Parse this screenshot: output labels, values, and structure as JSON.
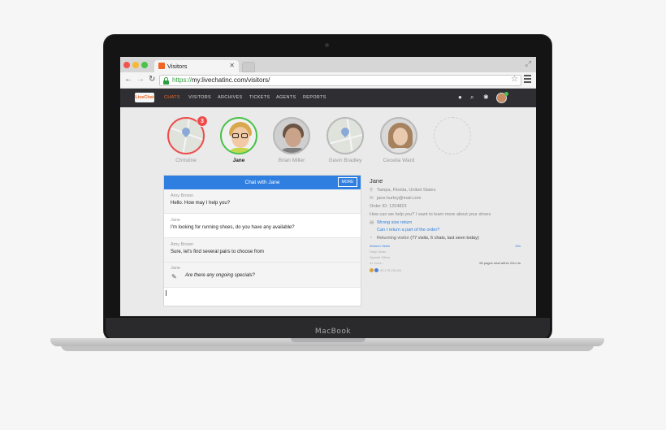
{
  "browser": {
    "tab_title": "Visitors",
    "url_scheme": "https://",
    "url_rest": "my.livechatinc.com/visitors/"
  },
  "app": {
    "logo_text": "LiveChat",
    "nav": [
      "CHATS",
      "VISITORS",
      "ARCHIVES",
      "TICKETS",
      "AGENTS",
      "REPORTS"
    ],
    "active_nav": "CHATS"
  },
  "visitors": [
    {
      "name": "Christine",
      "kind": "map",
      "badge": "3"
    },
    {
      "name": "Jane",
      "kind": "photo",
      "selected": true
    },
    {
      "name": "Brian Miller",
      "kind": "photo"
    },
    {
      "name": "Gavin Bradley",
      "kind": "map"
    },
    {
      "name": "Cecelia Ward",
      "kind": "photo"
    },
    {
      "name": "",
      "kind": "empty"
    }
  ],
  "chat": {
    "header": "Chat with Jane",
    "more_label": "MORE",
    "messages": [
      {
        "sender": "Amy Brown",
        "text": "Hello. How may I help you?"
      },
      {
        "sender": "Jane",
        "text": "I'm looking for running shoes, do you have any available?"
      },
      {
        "sender": "Amy Brown",
        "text": "Sure, let's find several pairs to choose from"
      },
      {
        "sender": "Jane",
        "text": "Are there any ongoing specials?"
      }
    ]
  },
  "details": {
    "name": "Jane",
    "location": "Tampa, Florida, United States",
    "email": "jane.hurley@mail.com",
    "order": "Order ID: 1204823",
    "question": "How can we help you? I want to learn more about your shoes",
    "links": [
      "Wrong size return",
      "Can I return a part of the order?"
    ],
    "returning_label": "Returning visitor",
    "returning_stats": "(77 visits, 6 chats, last seen today)",
    "page_lines": [
      "Women Heels",
      "Daily Deals",
      "Special Offers",
      "31 more..."
    ],
    "page_right_1": "52s",
    "page_right_2": "56 pages total within 22m 4s",
    "ip": "82.178.234.68"
  },
  "colors": {
    "accent": "#f26522",
    "chat_header": "#2f7fe0",
    "nav_bg": "#2f2f33",
    "badge": "#ef4b4b",
    "selected_ring": "#4bc24b"
  }
}
